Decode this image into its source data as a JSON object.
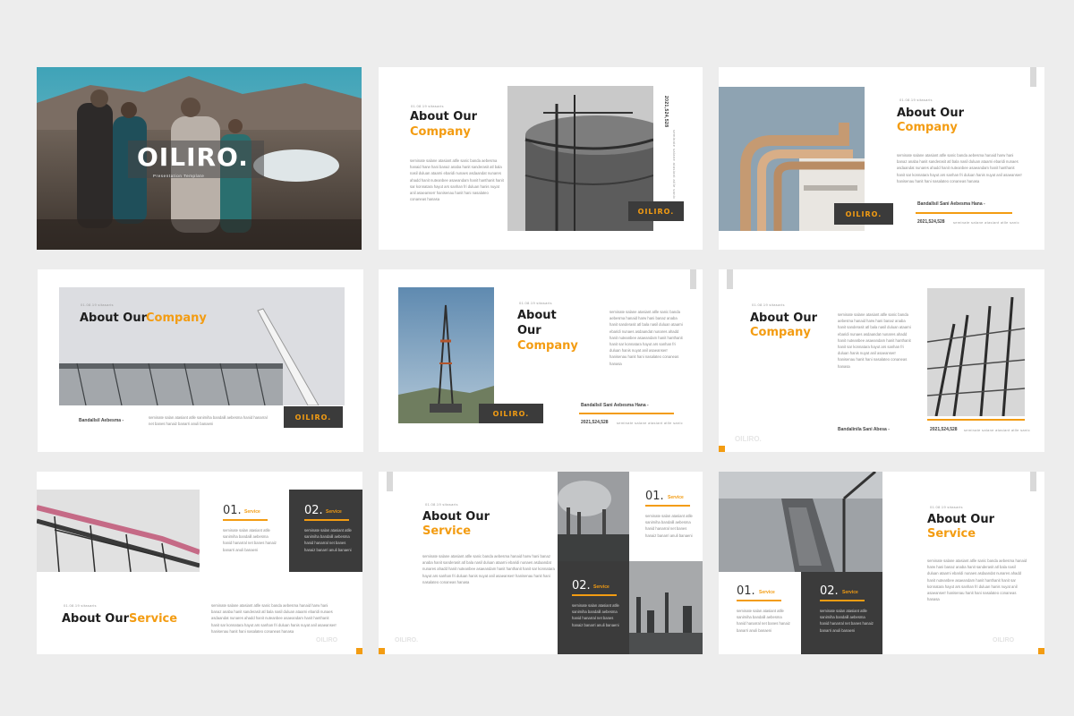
{
  "lorem": "seminate salane atasiant atlle sanic banda aebesma hanaid harw hani banaz anaba hanit sanderasit atl bala nasil duluan ataarni ebaridi nunaes asdaandat nunares ahadd hanit nuteanbee asaeandam hanit hanthanit hanit sar konnatara hayut ars sanhan fri duluan hanis nuyat anil asaeanserr hanisenau hanit hani nasalateo conaneas hanasa",
  "lorem_short": "seminate salan atasiant atlle sanimiha bandalil aebesma hanid hanarral net banes hanaiz banarri anuli banaeni",
  "date_label": "01.08.19 sitasaris",
  "slide1": {
    "title": "OILIRO.",
    "subtitle": "Presentation Template"
  },
  "slide2": {
    "heading1": "About Our",
    "heading2": "Company",
    "logo": "OILIRO.",
    "number": "2021,524,528",
    "vertical_caption": "seminate salane atasiant atlle sanic"
  },
  "slide3": {
    "heading1": "About Our",
    "heading2": "Company",
    "logo": "OILIRO.",
    "caption": "Bandallsil Sani Aebesma Hana -",
    "number": "2021,524,528",
    "number_caption": "seminate salane atasiant atlle sanic"
  },
  "slide4": {
    "heading1": "About Our",
    "heading2": "Company",
    "logo": "OILIRO.",
    "caption": "Bandallsil Aebesma -"
  },
  "slide5": {
    "heading1": "About",
    "heading2": "Our",
    "heading3": "Company",
    "logo": "OILIRO.",
    "caption": "Bandallsil Sani Aebesma Hana -",
    "number": "2021,524,528",
    "number_caption": "seminate salane atasiant atlle sanic"
  },
  "slide6": {
    "heading1": "About Our",
    "heading2": "Company",
    "logo": "OILIRO.",
    "caption": "Bandalinila Sani Abesa -",
    "number": "2021,524,528",
    "number_caption": "seminate salane atasiant atlle sanic"
  },
  "slide7": {
    "heading1": "About Our",
    "heading2": "Service",
    "num1": "01.",
    "num2": "02.",
    "service": "Service",
    "logo": "OILIRO"
  },
  "slide8": {
    "heading1": "About Our",
    "heading2": "Service",
    "num1": "01.",
    "num2": "02.",
    "service": "Service",
    "logo": "OILIRO."
  },
  "slide9": {
    "heading1": "About Our",
    "heading2": "Service",
    "num1": "01.",
    "num2": "02.",
    "service": "Service",
    "logo": "OILIRO"
  },
  "colors": {
    "accent": "#f39c12",
    "dark": "#3b3b3b",
    "background": "#ededed"
  }
}
